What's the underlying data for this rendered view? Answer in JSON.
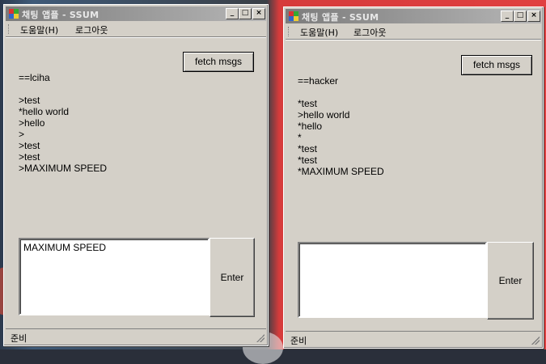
{
  "windows": [
    {
      "title": "채팅 앱플 - SSUM",
      "controls": {
        "minimize": "_",
        "maximize": "□",
        "close": "×"
      },
      "menu": [
        "도움말(H)",
        "로그아웃"
      ],
      "fetch_label": "fetch msgs",
      "messages": [
        "==lciha",
        "",
        ">test",
        "*hello world",
        ">hello",
        ">",
        ">test",
        ">test",
        ">MAXIMUM SPEED"
      ],
      "input_value": "MAXIMUM SPEED",
      "enter_label": "Enter",
      "status": "준비"
    },
    {
      "title": "채팅 앱플 - SSUM",
      "controls": {
        "minimize": "_",
        "maximize": "□",
        "close": "×"
      },
      "menu": [
        "도움말(H)",
        "로그아웃"
      ],
      "fetch_label": "fetch msgs",
      "messages": [
        "==hacker",
        "",
        "*test",
        ">hello world",
        "*hello",
        "*",
        "*test",
        "*test",
        "*MAXIMUM SPEED"
      ],
      "input_value": "",
      "enter_label": "Enter",
      "status": "준비"
    }
  ]
}
